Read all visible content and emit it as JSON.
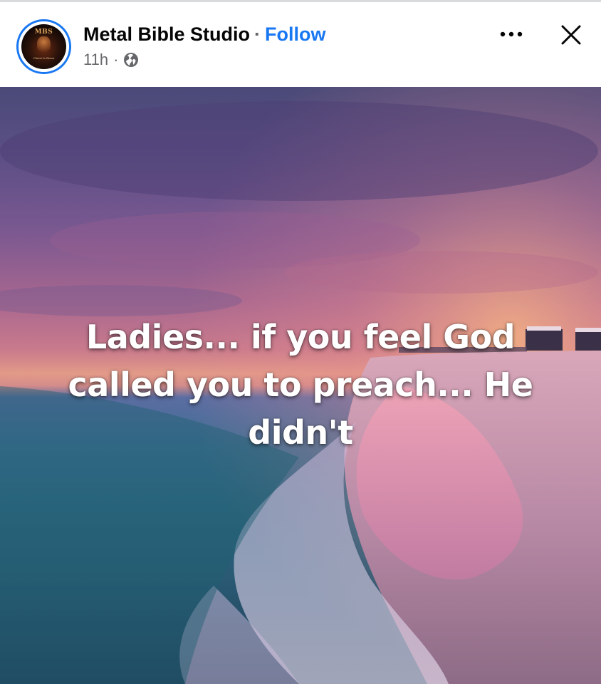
{
  "post": {
    "page_name": "Metal Bible Studio",
    "separator": "·",
    "follow_label": "Follow",
    "time": "11h",
    "meta_separator": "·",
    "privacy_icon": "globe-icon",
    "avatar": {
      "top_text": "MBS",
      "bottom_text": "Christ Is Risen"
    },
    "more_icon": "more-options-icon",
    "close_icon": "close-icon",
    "image_text": "Ladies... if you feel God called you to preach... He didn't"
  },
  "colors": {
    "accent": "#1877f2",
    "text_primary": "#050505",
    "text_secondary": "#65676b"
  }
}
